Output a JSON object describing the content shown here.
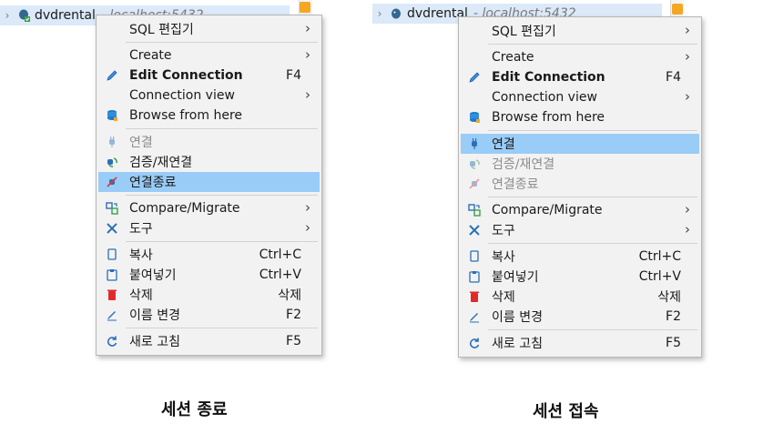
{
  "left": {
    "tree": {
      "name": "dvdrental",
      "host": "- localhost:5432"
    },
    "caption": "세션 종료",
    "menu": [
      {
        "label": "SQL 편집기",
        "arrow": true,
        "icon": "none"
      },
      {
        "sep": true
      },
      {
        "label": "Create",
        "arrow": true,
        "icon": "none"
      },
      {
        "label": "Edit Connection",
        "shortcut": "F4",
        "bold": true,
        "icon": "pencil-icon"
      },
      {
        "label": "Connection view",
        "arrow": true,
        "icon": "none"
      },
      {
        "label": "Browse from here",
        "icon": "database-icon"
      },
      {
        "sep": true
      },
      {
        "label": "연결",
        "disabled": true,
        "icon": "plug-icon"
      },
      {
        "label": "검증/재연결",
        "icon": "plug-refresh-icon"
      },
      {
        "label": "연결종료",
        "highlight": true,
        "icon": "plug-disconnect-icon"
      },
      {
        "sep": true
      },
      {
        "label": "Compare/Migrate",
        "arrow": true,
        "icon": "compare-icon"
      },
      {
        "label": "도구",
        "arrow": true,
        "icon": "tools-icon"
      },
      {
        "sep": true
      },
      {
        "label": "복사",
        "shortcut": "Ctrl+C",
        "icon": "copy-icon"
      },
      {
        "label": "붙여넣기",
        "shortcut": "Ctrl+V",
        "icon": "paste-icon"
      },
      {
        "label": "삭제",
        "shortcut": "삭제",
        "icon": "delete-icon"
      },
      {
        "label": "이름 변경",
        "shortcut": "F2",
        "icon": "rename-icon"
      },
      {
        "sep": true
      },
      {
        "label": "새로 고침",
        "shortcut": "F5",
        "icon": "refresh-icon"
      }
    ]
  },
  "right": {
    "tree": {
      "name": "dvdrental",
      "host": "- localhost:5432"
    },
    "caption": "세션 접속",
    "menu": [
      {
        "label": "SQL 편집기",
        "arrow": true,
        "icon": "none"
      },
      {
        "sep": true
      },
      {
        "label": "Create",
        "arrow": true,
        "icon": "none"
      },
      {
        "label": "Edit Connection",
        "shortcut": "F4",
        "bold": true,
        "icon": "pencil-icon"
      },
      {
        "label": "Connection view",
        "arrow": true,
        "icon": "none"
      },
      {
        "label": "Browse from here",
        "icon": "database-icon"
      },
      {
        "sep": true
      },
      {
        "label": "연결",
        "highlight": true,
        "icon": "plug-icon"
      },
      {
        "label": "검증/재연결",
        "disabled": true,
        "icon": "plug-refresh-icon"
      },
      {
        "label": "연결종료",
        "disabled": true,
        "icon": "plug-disconnect-icon"
      },
      {
        "sep": true
      },
      {
        "label": "Compare/Migrate",
        "arrow": true,
        "icon": "compare-icon"
      },
      {
        "label": "도구",
        "arrow": true,
        "icon": "tools-icon"
      },
      {
        "sep": true
      },
      {
        "label": "복사",
        "shortcut": "Ctrl+C",
        "icon": "copy-icon"
      },
      {
        "label": "붙여넣기",
        "shortcut": "Ctrl+V",
        "icon": "paste-icon"
      },
      {
        "label": "삭제",
        "shortcut": "삭제",
        "icon": "delete-icon"
      },
      {
        "label": "이름 변경",
        "shortcut": "F2",
        "icon": "rename-icon"
      },
      {
        "sep": true
      },
      {
        "label": "새로 고침",
        "shortcut": "F5",
        "icon": "refresh-icon"
      }
    ]
  }
}
